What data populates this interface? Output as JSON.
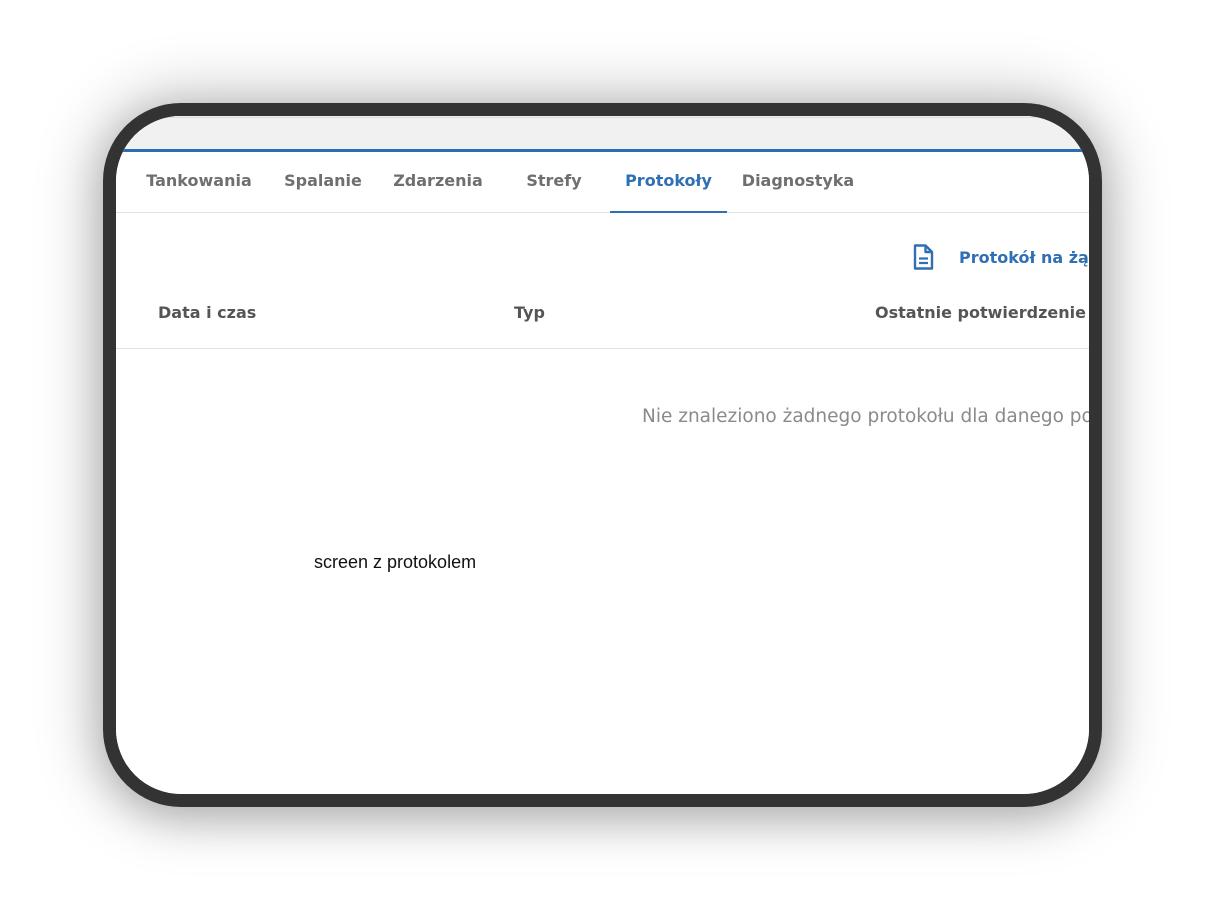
{
  "tabs": [
    {
      "label": "Tankowania",
      "active": false
    },
    {
      "label": "Spalanie",
      "active": false
    },
    {
      "label": "Zdarzenia",
      "active": false
    },
    {
      "label": "Strefy",
      "active": false
    },
    {
      "label": "Protokoły",
      "active": true
    },
    {
      "label": "Diagnostyka",
      "active": false
    }
  ],
  "action": {
    "label": "Protokół na żąd",
    "icon": "document-icon"
  },
  "table": {
    "columns": [
      "Data i czas",
      "Typ",
      "Ostatnie potwierdzenie"
    ],
    "empty_message": "Nie znaleziono żadnego protokołu dla danego poja"
  },
  "caption": "screen z protokolem",
  "colors": {
    "accent": "#2f6fb3",
    "frame": "#333333",
    "topbar": "#f1f1f1",
    "tab_inactive": "#6f6f6f",
    "muted_text": "#8a8a8a"
  }
}
